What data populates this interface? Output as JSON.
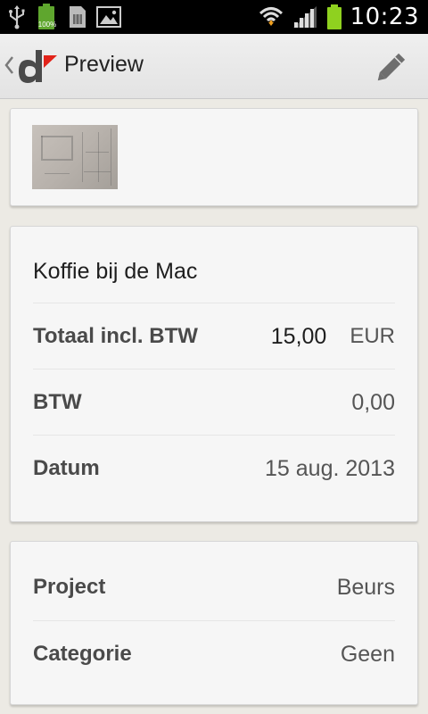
{
  "status_bar": {
    "time": "10:23",
    "battery_small_label": "100%",
    "icons": [
      "usb-icon",
      "battery-full-icon",
      "sim-card-icon",
      "gallery-icon",
      "wifi-icon",
      "signal-icon",
      "battery-charging-icon"
    ]
  },
  "action_bar": {
    "title": "Preview",
    "edit_icon": "pencil-icon",
    "accent_red": "#e2231a"
  },
  "expense": {
    "description": "Koffie bij de Mac",
    "rows": [
      {
        "label": "Totaal incl. BTW",
        "amount": "15,00",
        "currency": "EUR"
      },
      {
        "label": "BTW",
        "value": "0,00"
      },
      {
        "label": "Datum",
        "value": "15 aug. 2013"
      }
    ]
  },
  "classification": {
    "rows": [
      {
        "label": "Project",
        "value": "Beurs"
      },
      {
        "label": "Categorie",
        "value": "Geen"
      }
    ]
  }
}
